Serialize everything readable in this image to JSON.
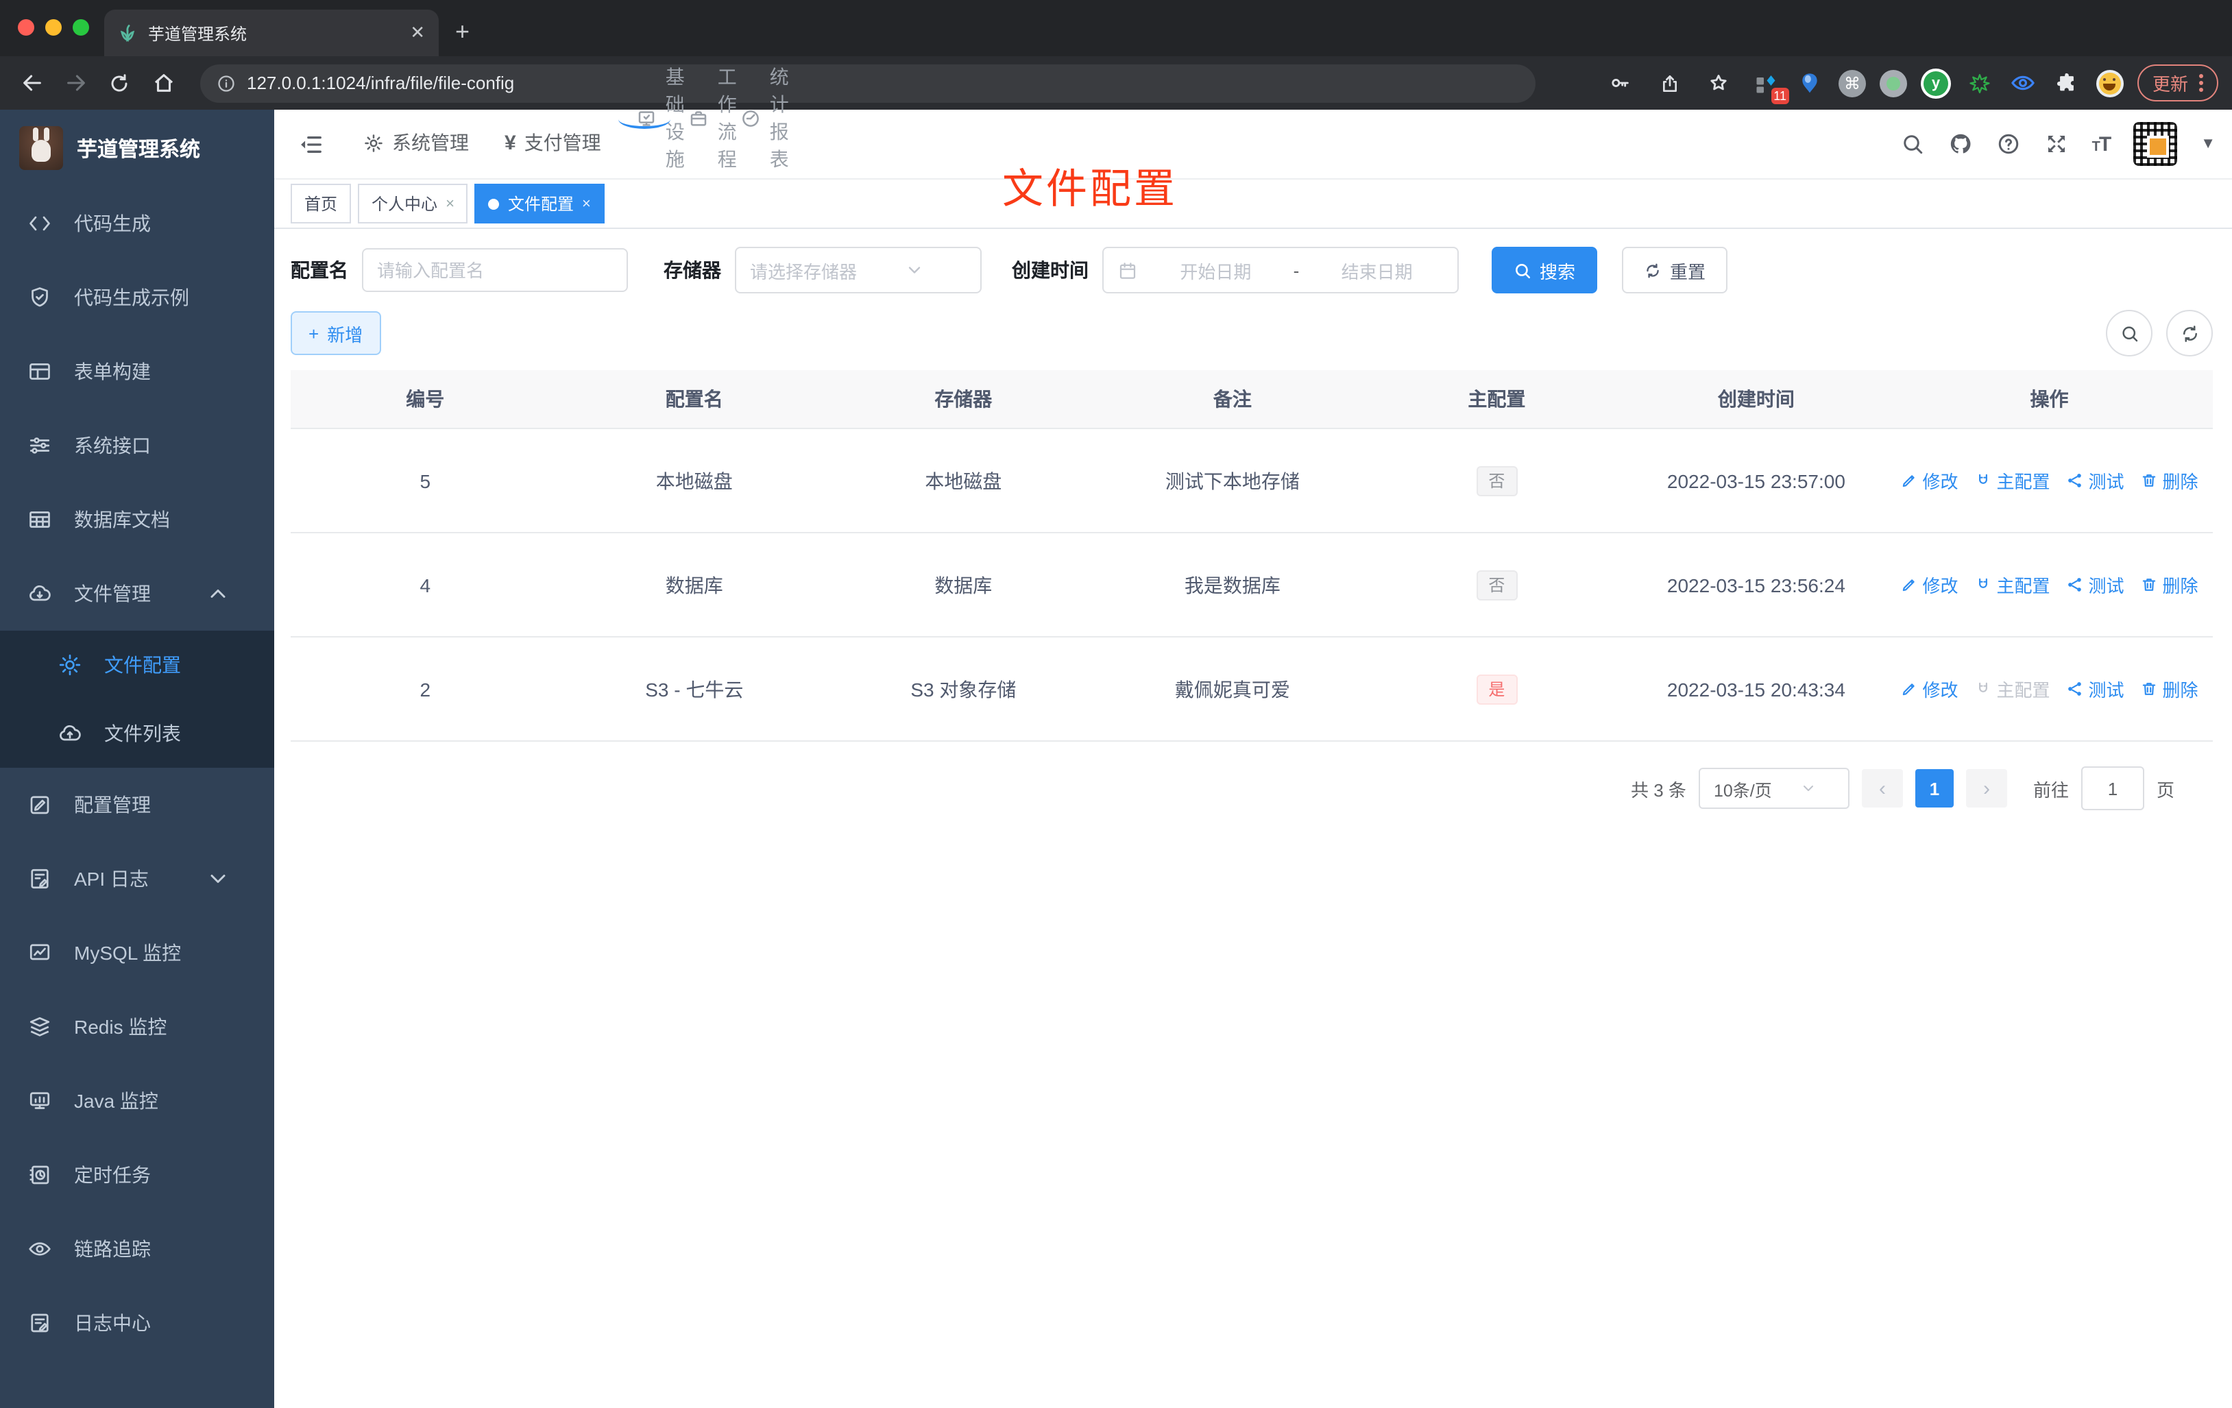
{
  "colors": {
    "accent": "#2d8cf0",
    "sidebar_bg": "#304156",
    "submenu_bg": "#1f2d3d",
    "sidebar_active": "#409eff",
    "annotation": "#f93b17",
    "tag_info": "#909399",
    "tag_danger": "#f56c6c"
  },
  "browser": {
    "tab_title": "芋道管理系统",
    "url": "127.0.0.1:1024/infra/file/file-config",
    "update_label": "更新",
    "extension_badge": "11",
    "cmd_glyph": "⌘",
    "y_glyph": "y"
  },
  "sidebar": {
    "title": "芋道管理系统",
    "items": [
      {
        "label": "代码生成"
      },
      {
        "label": "代码生成示例"
      },
      {
        "label": "表单构建"
      },
      {
        "label": "系统接口"
      },
      {
        "label": "数据库文档"
      },
      {
        "label": "文件管理"
      },
      {
        "label": "文件配置"
      },
      {
        "label": "文件列表"
      },
      {
        "label": "配置管理"
      },
      {
        "label": "API 日志"
      },
      {
        "label": "MySQL 监控"
      },
      {
        "label": "Redis 监控"
      },
      {
        "label": "Java 监控"
      },
      {
        "label": "定时任务"
      },
      {
        "label": "链路追踪"
      },
      {
        "label": "日志中心"
      }
    ]
  },
  "navbar": {
    "menus": [
      "系统管理",
      "支付管理",
      "基础设施",
      "工作流程",
      "统计报表"
    ],
    "yen": "¥"
  },
  "tabs": {
    "home": "首页",
    "profile": "个人中心",
    "current": "文件配置",
    "close": "×"
  },
  "annotation": {
    "text": "文件配置"
  },
  "filters": {
    "name_label": "配置名",
    "name_placeholder": "请输入配置名",
    "storage_label": "存储器",
    "storage_placeholder": "请选择存储器",
    "time_label": "创建时间",
    "start_placeholder": "开始日期",
    "range_separator": "-",
    "end_placeholder": "结束日期",
    "search_label": "搜索",
    "reset_label": "重置"
  },
  "toolbar": {
    "add_label": "新增",
    "plus": "+"
  },
  "table": {
    "headers": [
      "编号",
      "配置名",
      "存储器",
      "备注",
      "主配置",
      "创建时间",
      "操作"
    ],
    "actions": {
      "edit": "修改",
      "master": "主配置",
      "test": "测试",
      "delete": "删除"
    },
    "rows": [
      {
        "id": "5",
        "name": "本地磁盘",
        "storage": "本地磁盘",
        "remark": "测试下本地存储",
        "master": "否",
        "created": "2022-03-15 23:57:00"
      },
      {
        "id": "4",
        "name": "数据库",
        "storage": "数据库",
        "remark": "我是数据库",
        "master": "否",
        "created": "2022-03-15 23:56:24"
      },
      {
        "id": "2",
        "name": "S3 - 七牛云",
        "storage": "S3 对象存储",
        "remark": "戴佩妮真可爱",
        "master": "是",
        "created": "2022-03-15 20:43:34"
      }
    ]
  },
  "pagination": {
    "total": "共 3 条",
    "page_size": "10条/页",
    "prev": "‹",
    "page": "1",
    "next": "›",
    "goto_label": "前往",
    "goto_value": "1",
    "page_unit": "页"
  }
}
